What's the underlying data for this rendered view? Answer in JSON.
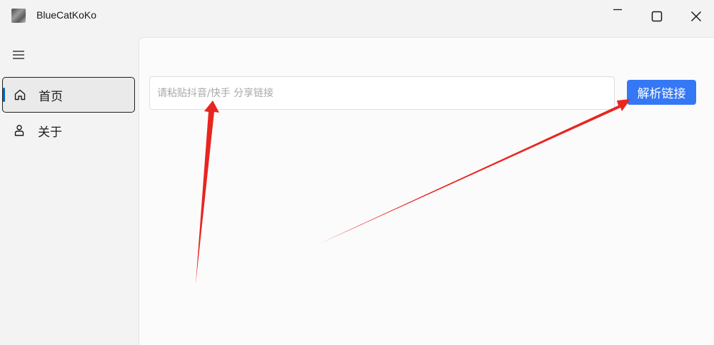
{
  "window": {
    "title": "BlueCatKoKo",
    "controls": [
      "minimize",
      "maximize",
      "close"
    ]
  },
  "sidebar": {
    "menu_icon": "hamburger-menu-icon",
    "items": [
      {
        "label": "首页",
        "icon": "home-icon",
        "active": true
      },
      {
        "label": "关于",
        "icon": "person-icon",
        "active": false
      }
    ]
  },
  "main": {
    "link_input": {
      "placeholder": "请粘贴抖音/快手 分享链接",
      "value": ""
    },
    "parse_button": {
      "label": "解析链接"
    }
  },
  "colors": {
    "accent": "#3478f6",
    "nav_indicator": "#0067c0",
    "annotation_arrow": "#e8251f"
  }
}
